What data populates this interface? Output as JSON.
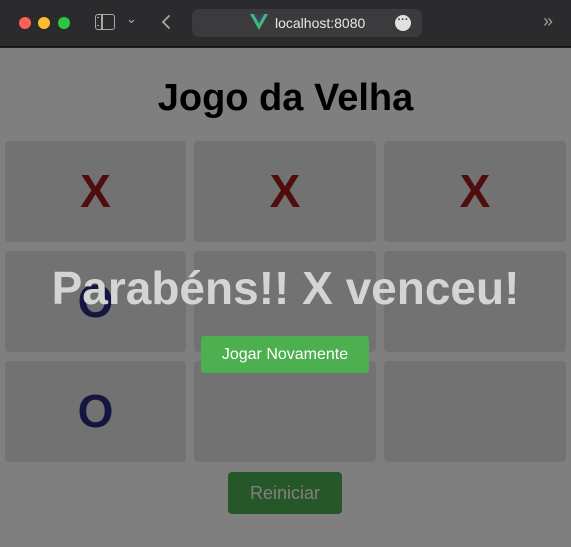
{
  "browser": {
    "url": "localhost:8080",
    "more_icon": "ellipsis-icon"
  },
  "game": {
    "title": "Jogo da Velha",
    "board": [
      "X",
      "X",
      "X",
      "O",
      "",
      "",
      "O",
      "",
      ""
    ],
    "reset_label": "Reiniciar"
  },
  "overlay": {
    "message": "Parabéns!! X venceu!",
    "play_again_label": "Jogar Novamente"
  },
  "colors": {
    "x": "#a01a1a",
    "o": "#2b2a84",
    "button": "#4caf50"
  }
}
